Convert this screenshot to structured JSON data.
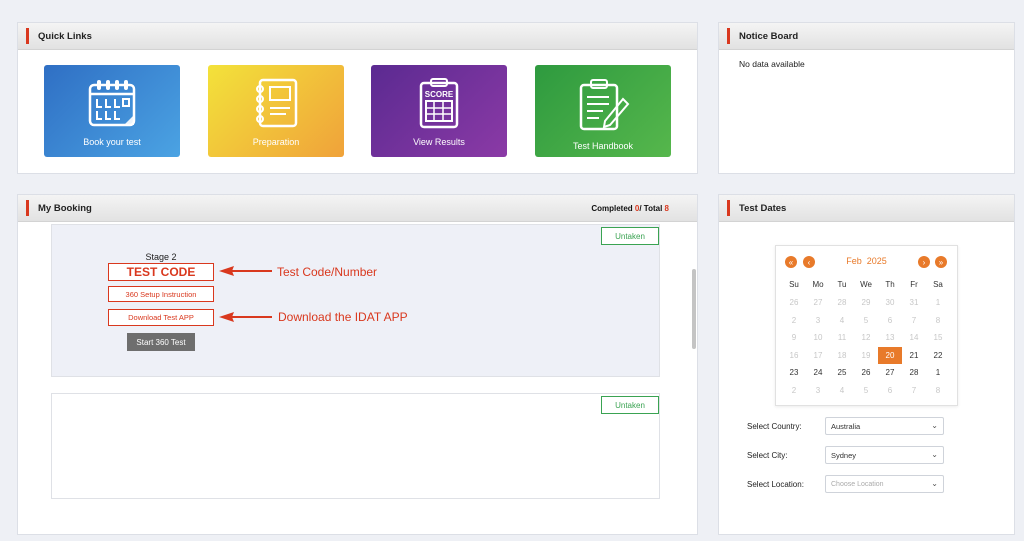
{
  "quick_links": {
    "title": "Quick Links",
    "tiles": [
      {
        "label": "Book your test",
        "color_from": "#2f6fc4",
        "color_to": "#4ba3e3"
      },
      {
        "label": "Preparation",
        "color_from": "#f3e23a",
        "color_to": "#f0a23a"
      },
      {
        "label": "View Results",
        "color_from": "#5b2a91",
        "color_to": "#8b3aa6"
      },
      {
        "label": "Test Handbook",
        "color_from": "#2e9a3f",
        "color_to": "#56b74c"
      }
    ],
    "score_text": "SCORE"
  },
  "notice_board": {
    "title": "Notice Board",
    "message": "No data available"
  },
  "my_booking": {
    "title": "My Booking",
    "completed_label": "Completed ",
    "completed_value": "0",
    "total_label": "/ Total ",
    "total_value": "8",
    "cards": [
      {
        "status": "Untaken",
        "stage": "Stage 2",
        "test_code": "TEST CODE",
        "setup_button": "360 Setup Instruction",
        "download_button": "Download Test APP",
        "start_button": "Start 360 Test"
      },
      {
        "status": "Untaken"
      }
    ],
    "annotations": {
      "code_note": "Test Code/Number",
      "app_note": "Download the IDAT APP"
    }
  },
  "test_dates": {
    "title": "Test Dates",
    "calendar": {
      "month": "Feb",
      "year": "2025",
      "weekdays": [
        "Su",
        "Mo",
        "Tu",
        "We",
        "Th",
        "Fr",
        "Sa"
      ],
      "days": [
        "26",
        "27",
        "28",
        "29",
        "30",
        "31",
        "1",
        "2",
        "3",
        "4",
        "5",
        "6",
        "7",
        "8",
        "9",
        "10",
        "11",
        "12",
        "13",
        "14",
        "15",
        "16",
        "17",
        "18",
        "19",
        "20",
        "21",
        "22",
        "23",
        "24",
        "25",
        "26",
        "27",
        "28",
        "1",
        "2",
        "3",
        "4",
        "5",
        "6",
        "7",
        "8"
      ],
      "enabled_from_index": 25,
      "enabled_to_index": 34,
      "selected_index": 25
    },
    "country_label": "Select Country:",
    "country_value": "Australia",
    "city_label": "Select City:",
    "city_value": "Sydney",
    "location_label": "Select Location:",
    "location_placeholder": "Choose Location"
  },
  "colors": {
    "accent": "#d9381e",
    "calendar_accent": "#e87a2a",
    "status_green": "#3aa352"
  }
}
